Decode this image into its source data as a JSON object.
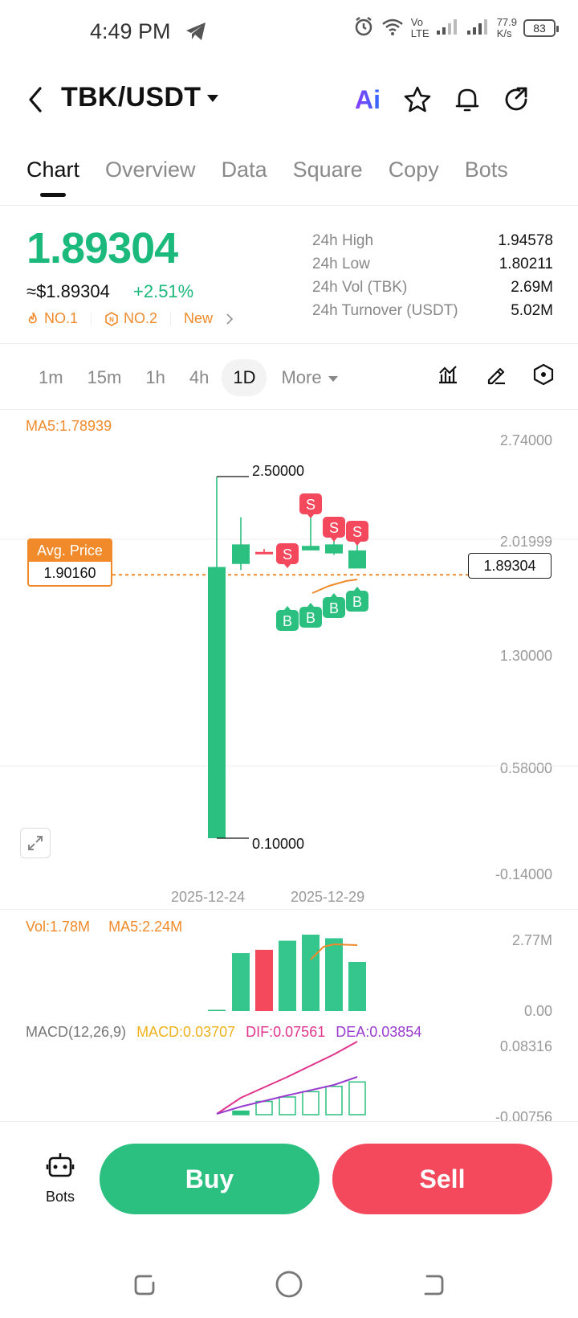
{
  "status_bar": {
    "time": "4:49 PM",
    "net_top": "Vo",
    "net_bottom": "LTE",
    "speed_top": "77.9",
    "speed_bottom": "K/s",
    "battery": "83"
  },
  "header": {
    "pair": "TBK/USDT",
    "ai_label": "Ai"
  },
  "tabs": [
    {
      "label": "Chart",
      "active": true
    },
    {
      "label": "Overview"
    },
    {
      "label": "Data"
    },
    {
      "label": "Square"
    },
    {
      "label": "Copy"
    },
    {
      "label": "Bots"
    }
  ],
  "ticker": {
    "price": "1.89304",
    "usd_price": "≈$1.89304",
    "change": "+2.51%",
    "badges": [
      "NO.1",
      "NO.2",
      "New"
    ],
    "stats": [
      {
        "label": "24h  High",
        "value": "1.94578"
      },
      {
        "label": "24h  Low",
        "value": "1.80211"
      },
      {
        "label": "24h  Vol (TBK)",
        "value": "2.69M"
      },
      {
        "label": "24h  Turnover (USDT)",
        "value": "5.02M"
      }
    ]
  },
  "intervals": [
    "1m",
    "15m",
    "1h",
    "4h",
    "1D",
    "More"
  ],
  "active_interval": "1D",
  "chart": {
    "ma5_label": "MA5:1.78939",
    "avg_price_label": "Avg. Price",
    "avg_price_value": "1.90160",
    "current_price_tag": "1.89304",
    "high_marker": "2.50000",
    "low_marker": "0.10000",
    "y_axis": [
      "2.74000",
      "2.01999",
      "1.30000",
      "0.58000",
      "-0.14000"
    ],
    "x_axis": [
      "2025-12-24",
      "2025-12-29"
    ],
    "volume_label": "Vol:1.78M",
    "volume_ma5_label": "MA5:2.24M",
    "volume_axis": [
      "2.77M",
      "0.00"
    ],
    "macd_label": "MACD(12,26,9)",
    "macd_value": "MACD:0.03707",
    "dif_value": "DIF:0.07561",
    "dea_value": "DEA:0.03854",
    "macd_axis": [
      "0.08316",
      "-0.00756"
    ],
    "sell_marker": "S",
    "buy_marker": "B"
  },
  "chart_data": {
    "type": "candlestick",
    "candles": [
      {
        "open": 0.1,
        "high": 2.5,
        "low": 0.1,
        "close": 1.9
      },
      {
        "open": 1.92,
        "high": 2.23,
        "low": 1.88,
        "close": 2.05
      },
      {
        "open": 2.0,
        "high": 2.02,
        "low": 1.99,
        "close": 2.0
      },
      {
        "open": 2.0,
        "high": 2.03,
        "low": 1.98,
        "close": 2.0
      },
      {
        "open": 2.01,
        "high": 2.23,
        "low": 2.01,
        "close": 2.04
      },
      {
        "open": 1.99,
        "high": 2.1,
        "low": 1.98,
        "close": 2.05
      },
      {
        "open": 2.01,
        "high": 2.06,
        "low": 1.99,
        "close": 1.89
      }
    ],
    "volume": [
      0.02,
      2.1,
      2.22,
      2.55,
      2.77,
      2.64,
      1.78
    ],
    "volume_colors": [
      "#2bc07f",
      "#2bc07f",
      "#f4485d",
      "#2bc07f",
      "#2bc07f",
      "#2bc07f",
      "#2bc07f"
    ],
    "macd_hist": [
      0.0,
      0.004,
      0.015,
      0.02,
      0.026,
      0.032,
      0.037
    ],
    "ylim": [
      -0.14,
      2.74
    ],
    "colors": {
      "up": "#2bc07f",
      "down": "#f4485d",
      "ma": "#f08a2a",
      "dif": "#e0358c",
      "dea": "#9a3cd0"
    }
  },
  "bottom_bar": {
    "bots_label": "Bots",
    "buy_label": "Buy",
    "sell_label": "Sell"
  }
}
